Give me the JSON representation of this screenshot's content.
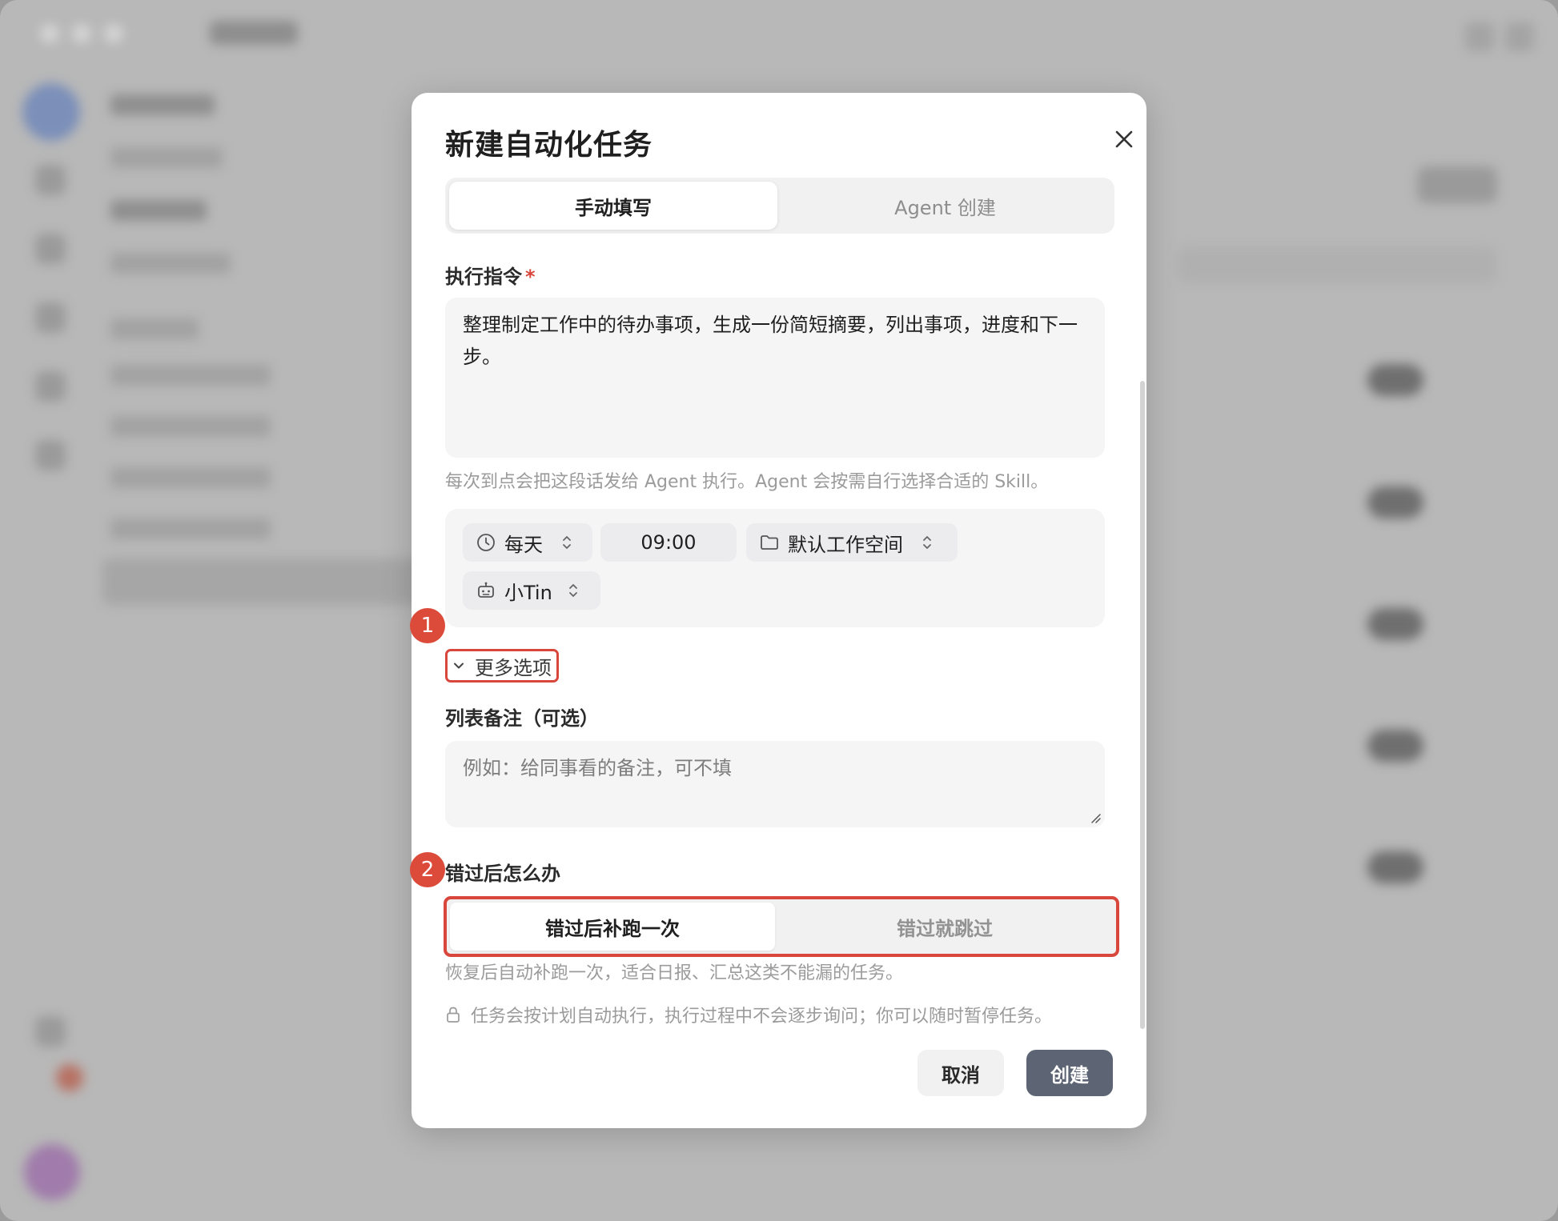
{
  "dialog": {
    "title": "新建自动化任务",
    "tabs": [
      {
        "label": "手动填写",
        "active": true
      },
      {
        "label": "Agent 创建",
        "active": false
      }
    ]
  },
  "instruction": {
    "label": "执行指令",
    "required_mark": "*",
    "value": "整理制定工作中的待办事项，生成一份简短摘要，列出事项，进度和下一步。",
    "hint": "每次到点会把这段话发给 Agent 执行。Agent 会按需自行选择合适的 Skill。"
  },
  "schedule": {
    "frequency": "每天",
    "time": "09:00",
    "workspace": "默认工作空间",
    "agent": "小Tin"
  },
  "more_options": {
    "label": "更多选项",
    "step": "1"
  },
  "list_note": {
    "label": "列表备注（可选）",
    "placeholder": "例如：给同事看的备注，可不填"
  },
  "missed_run": {
    "label": "错过后怎么办",
    "step": "2",
    "options": [
      {
        "label": "错过后补跑一次",
        "selected": true
      },
      {
        "label": "错过就跳过",
        "selected": false
      }
    ],
    "hint": "恢复后自动补跑一次，适合日报、汇总这类不能漏的任务。"
  },
  "security_note": "任务会按计划自动执行，执行过程中不会逐步询问；你可以随时暂停任务。",
  "buttons": {
    "cancel": "取消",
    "create": "创建"
  },
  "colors": {
    "accent_red": "#d9463c",
    "create_button": "#5d6473"
  },
  "icons": {
    "close": "close-icon",
    "frequency": "clock-icon",
    "workspace": "folder-icon",
    "agent": "robot-icon",
    "select": "chevron-up-down-icon",
    "expand": "chevron-down-icon",
    "note": "lock-icon"
  }
}
